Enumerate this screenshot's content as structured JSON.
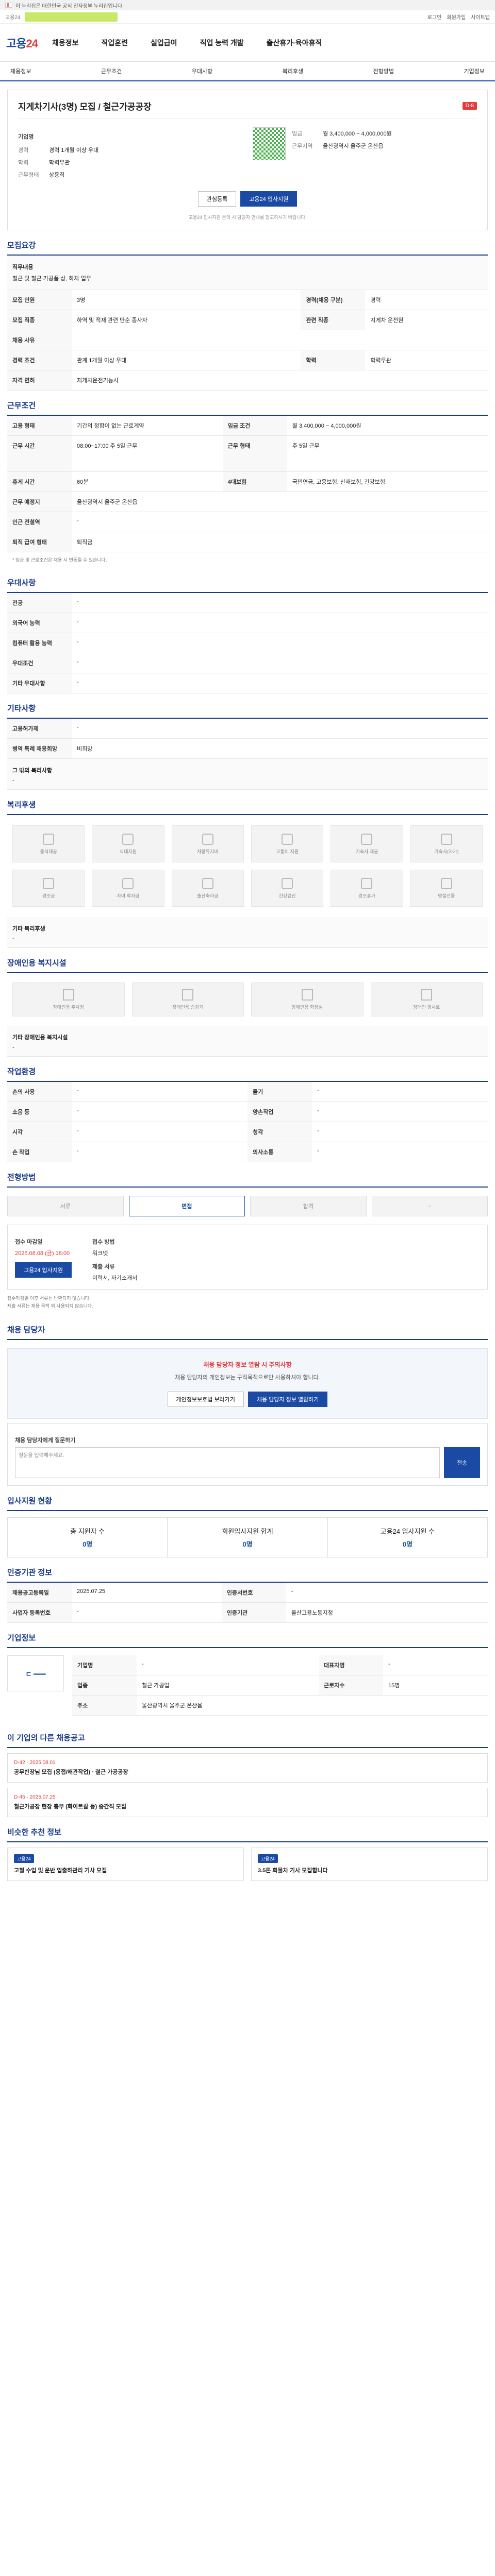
{
  "gov_banner": "이 누리집은 대한민국 공식 전자정부 누리집입니다.",
  "top": {
    "promo": "고용24",
    "links": [
      "로그인",
      "회원가입",
      "사이트맵"
    ]
  },
  "header": {
    "logo_main": "고용",
    "logo_num": "24",
    "menu": [
      "채용정보",
      "직업훈련",
      "실업급여",
      "직업 능력 개발",
      "출산휴가·육아휴직"
    ]
  },
  "subnav": [
    "채용정보",
    "근무조건",
    "우대사항",
    "복리후생",
    "전형방법",
    "기업정보"
  ],
  "job": {
    "title": "지게차기사(3명) 모집 / 철근가공공장",
    "dday": "D-8",
    "company_label": "기업명",
    "company": "",
    "labels": [
      "경력",
      "학력",
      "근무형태",
      "임금",
      "근무지역"
    ],
    "career": "경력 1개월 이상 우대",
    "edu": "학력무관",
    "work": "상용직",
    "wage": "월 3,400,000 ~ 4,000,000원",
    "region": "울산광역시 울주군 온산읍",
    "btn_save": "관심등록",
    "btn_apply": "고용24 입사지원",
    "note": "고용24 입사지원 문의 시 담당자 안내를 참고하시기 바랍니다."
  },
  "sections": {
    "recruit": {
      "title": "모집요강",
      "duty_label": "직무내용",
      "duty": "철근 및 철근 가공품 상, 하차 업무",
      "rows": [
        [
          "모집 인원",
          "3명",
          "경력(채용 구분)",
          "경력"
        ],
        [
          "모집 직종",
          "하역 및 적재 관련 단순 종사자",
          "관련 직종",
          "지게차 운전원"
        ],
        [
          "채용 사유",
          "",
          "",
          " "
        ],
        [
          "경력 조건",
          "관계 1개월 이상 우대",
          "학력",
          "학력무관"
        ],
        [
          "자격 면허",
          "지게차운전기능사",
          "",
          ""
        ]
      ]
    },
    "conditions": {
      "title": "근무조건",
      "rows": [
        [
          "고용 형태",
          "기간의 정함이 없는 근로계약",
          "임금 조건",
          "월 3,400,000 ~ 4,000,000원"
        ],
        [
          "근무 시간",
          "08:00~17:00 주 5일 근무",
          "근무 형태",
          "주 5일 근무"
        ],
        [
          "휴게 시간",
          "60분",
          "4대보험",
          "국민연금, 고용보험, 산재보험, 건강보험"
        ],
        [
          "근무 예정지",
          "울산광역시 울주군 온산읍",
          "",
          ""
        ],
        [
          "인근 전철역",
          "-",
          "",
          ""
        ],
        [
          "퇴직 급여 형태",
          "퇴직금",
          "",
          ""
        ]
      ],
      "note": "* 임금 및 근로조건은 채용 시 변동될 수 있습니다."
    },
    "pref": {
      "title": "우대사항",
      "rows": [
        [
          "전공",
          "-"
        ],
        [
          "외국어 능력",
          "-"
        ],
        [
          "컴퓨터 활용 능력",
          "-"
        ],
        [
          "우대조건",
          "-"
        ],
        [
          "기타 우대사항",
          "-"
        ]
      ]
    },
    "other": {
      "title": "기타사항",
      "rows": [
        [
          "고용허가제",
          "-"
        ],
        [
          "병역 특례 채용희망",
          "비희망"
        ]
      ],
      "input_label": "그 밖의 복리사항",
      "input_value": "-"
    },
    "welfare": {
      "title": "복리후생",
      "items": [
        "중식제공",
        "식대지원",
        "차량유지비",
        "교통비 지원",
        "기숙사 제공",
        "기숙사(자가)",
        "경조금",
        "자녀 학자금",
        "출산축하금",
        "건강검진",
        "경조휴가",
        "명절선물"
      ],
      "note_label": "기타 복리후생",
      "note_value": "-"
    },
    "disability": {
      "title": "장애인용 복지시설",
      "items": [
        "장애인용 주차장",
        "장애인용 승강기",
        "장애인용 화장실",
        "장애인 경사로"
      ],
      "note_label": "기타 장애인용 복지시설",
      "note_value": "-"
    },
    "workplace": {
      "title": "작업환경",
      "rows": [
        [
          "손의 사용",
          "-",
          "들기",
          "-"
        ],
        [
          "소음 등",
          "-",
          "양손작업",
          "-"
        ],
        [
          "시각",
          "-",
          "청각",
          "-"
        ],
        [
          "손 작업",
          "-",
          "의사소통",
          "-"
        ]
      ]
    },
    "process": {
      "title": "전형방법",
      "steps": [
        "서류",
        "면접",
        "합격",
        "-"
      ],
      "deadline_label": "접수 마감일",
      "deadline": "2025.08.08 (금) 18:00",
      "method_label": "접수 방법",
      "method": "워크넷",
      "submit_label": "제출 서류",
      "submit": "이력서, 자기소개서",
      "notes": [
        "접수마감일 이후 서류는 반환되지 않습니다.",
        "제출 서류는 채용 목적 외 사용되지 않습니다."
      ]
    },
    "contact": {
      "title": "채용 담당자",
      "warn_title": "채용 담당자 정보 열람 시 주의사항",
      "warn_text": "채용 담당자의 개인정보는 구직목적으로만 사용하셔야 합니다.",
      "btn1": "개인정보보호법 보러가기",
      "btn2": "채용 담당자 정보 열람하기",
      "qa_label": "채용 담당자에게 질문하기",
      "qa_placeholder": "질문을 입력해주세요.",
      "qa_btn": "전송"
    },
    "stats": {
      "title": "입사지원 현황",
      "items": [
        [
          "총 지원자 수",
          "0명"
        ],
        [
          "회원입사지원 합계",
          "0명"
        ],
        [
          "고용24 입사지원 수",
          "0명"
        ]
      ]
    },
    "info": {
      "title": "인증기관 정보",
      "rows": [
        [
          "채용공고등록일",
          "2025.07.25",
          "인증서번호",
          "-"
        ],
        [
          "사업자 등록번호",
          "-",
          "인증기관",
          "울산고용노동지청"
        ]
      ]
    },
    "company": {
      "title": "기업정보",
      "name": "",
      "rows": [
        [
          "기업명",
          "-",
          "대표자명",
          "-"
        ],
        [
          "업종",
          "철근 가공업",
          "근로자수",
          "15명"
        ],
        [
          "주소",
          "울산광역시 울주군 온산읍",
          "",
          " "
        ]
      ]
    },
    "other_jobs": {
      "title": "이 기업의 다른 채용공고",
      "cards": [
        {
          "d": "D-42 · 2025.08.01",
          "t": "공무반장님 모집 (용접/배관작업) · 철근 가공공장"
        },
        {
          "d": "D-45 · 2025.07.25",
          "t": "철근가공장 현장 총무 (화이트칼 등) 중간직 모집"
        }
      ]
    },
    "recommend": {
      "title": "비슷한 추천 정보",
      "cards": [
        {
          "d": "고용24",
          "t": "고철 수입 및 운반 입출하관리 기사 모집"
        },
        {
          "d": "고용24",
          "t": "3.5톤 화물차 기사 모집합니다"
        }
      ]
    }
  }
}
